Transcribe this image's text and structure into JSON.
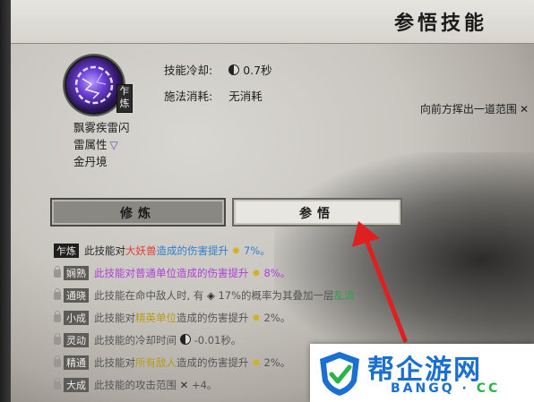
{
  "header": {
    "title": "参悟技能"
  },
  "skill": {
    "level_tag": "乍炼",
    "name": "飘雾疾雷闪",
    "attribute": "雷属性",
    "realm": "金丹境",
    "cooldown_label": "技能冷却:",
    "cooldown_value": "0.7秒",
    "cost_label": "施法消耗:",
    "cost_value": "无消耗",
    "range_description": "向前方挥出一道范围"
  },
  "tabs": [
    {
      "label": "修炼",
      "selected": false
    },
    {
      "label": "参悟",
      "selected": true
    }
  ],
  "effects": [
    {
      "stage": "乍炼",
      "locked": false,
      "pre": "此技能对",
      "target": "大妖兽",
      "post": "造成的伤害提升",
      "value": "7%。"
    },
    {
      "stage": "娴熟",
      "locked": true,
      "pre": "此技能对",
      "target": "普通单位",
      "post": "造成的伤害提升",
      "value": "8%。"
    },
    {
      "stage": "通晓",
      "locked": true,
      "pre": "此技能在命中敌人时, 有",
      "value": "17%的概率为其叠加一层",
      "target": "乱流"
    },
    {
      "stage": "小成",
      "locked": true,
      "pre": "此技能对",
      "target": "精英单位",
      "post": "造成的伤害提升",
      "value": "2%。"
    },
    {
      "stage": "灵动",
      "locked": true,
      "pre": "此技能的冷却时间",
      "value": "-0.01秒。"
    },
    {
      "stage": "精通",
      "locked": true,
      "pre": "此技能对",
      "target": "所有敌人",
      "post": "造成的伤害提升",
      "value": "2%。"
    },
    {
      "stage": "大成",
      "locked": true,
      "pre": "此技能的攻击范围",
      "value": "+4。"
    }
  ],
  "watermark": {
    "brand": "帮企游网",
    "domain": "BANGQ",
    "tld": "CC"
  },
  "colors": {
    "accent_arrow": "#e02020",
    "watermark_blue": "#1a6fd0",
    "watermark_green": "#29b34a"
  }
}
